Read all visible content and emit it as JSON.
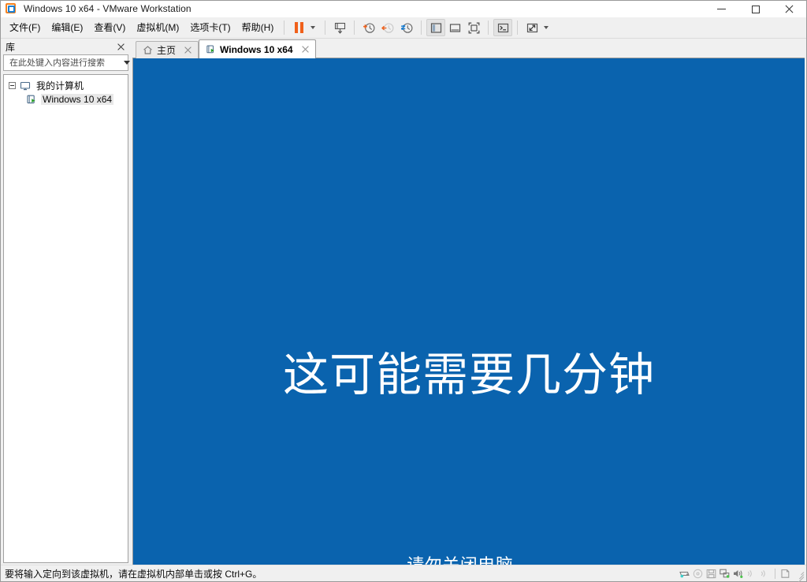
{
  "window": {
    "title": "Windows 10 x64 - VMware Workstation",
    "app_icon": "vmware-logo-icon",
    "controls": {
      "minimize": "minimize-icon",
      "maximize": "maximize-icon",
      "close": "close-icon"
    }
  },
  "menu": {
    "items": [
      {
        "label": "文件(F)",
        "mnemonic": "F"
      },
      {
        "label": "编辑(E)",
        "mnemonic": "E"
      },
      {
        "label": "查看(V)",
        "mnemonic": "V"
      },
      {
        "label": "虚拟机(M)",
        "mnemonic": "M"
      },
      {
        "label": "选项卡(T)",
        "mnemonic": "T"
      },
      {
        "label": "帮助(H)",
        "mnemonic": "H"
      }
    ]
  },
  "toolbar": {
    "groups": [
      {
        "buttons": [
          {
            "name": "suspend-button",
            "icon": "pause-icon",
            "active": false
          },
          {
            "name": "power-dropdown",
            "icon": "chevron-down-icon",
            "active": false
          }
        ]
      },
      {
        "buttons": [
          {
            "name": "manage-vm-button",
            "icon": "vm-settings-icon",
            "active": false
          }
        ]
      },
      {
        "buttons": [
          {
            "name": "take-snapshot-button",
            "icon": "snapshot-add-icon",
            "active": false
          },
          {
            "name": "revert-snapshot-button",
            "icon": "snapshot-revert-icon",
            "active": false
          },
          {
            "name": "snapshot-manager-button",
            "icon": "snapshot-manager-icon",
            "active": false
          }
        ]
      },
      {
        "buttons": [
          {
            "name": "show-library-button",
            "icon": "library-panel-icon",
            "active": true
          },
          {
            "name": "show-thumbnail-bar-button",
            "icon": "thumbnail-bar-icon",
            "active": false
          },
          {
            "name": "full-screen-button",
            "icon": "fullscreen-icon",
            "active": false
          }
        ]
      },
      {
        "buttons": [
          {
            "name": "console-view-button",
            "icon": "console-icon",
            "active": true
          }
        ]
      },
      {
        "buttons": [
          {
            "name": "stretch-view-button",
            "icon": "stretch-icon",
            "active": false
          },
          {
            "name": "stretch-dropdown",
            "icon": "chevron-down-icon",
            "active": false
          }
        ]
      }
    ]
  },
  "library": {
    "title": "库",
    "close_label": "close-icon",
    "search": {
      "placeholder": "在此处键入内容进行搜索",
      "value": "",
      "icon": "search-icon",
      "dropdown_icon": "chevron-down-icon"
    },
    "tree": [
      {
        "label": "我的计算机",
        "icon": "monitor-icon",
        "expanded": true,
        "selected": false,
        "children": [
          {
            "label": "Windows 10 x64",
            "icon": "vm-running-icon",
            "selected": true
          }
        ]
      }
    ]
  },
  "tabs": [
    {
      "label": "主页",
      "icon": "home-icon",
      "active": false,
      "closable": true
    },
    {
      "label": "Windows 10 x64",
      "icon": "vm-running-icon",
      "active": true,
      "closable": true
    }
  ],
  "vm_screen": {
    "background_color": "#0A63AE",
    "headline": "这可能需要几分钟",
    "subtext": "请勿关闭电脑。"
  },
  "status_bar": {
    "message": "要将输入定向到该虚拟机，请在虚拟机内部单击或按 Ctrl+G。",
    "devices": [
      {
        "name": "hard-disk-icon",
        "label": "硬盘",
        "connected": true
      },
      {
        "name": "cd-dvd-icon",
        "label": "CD/DVD",
        "connected": false
      },
      {
        "name": "floppy-icon",
        "label": "软盘",
        "connected": false
      },
      {
        "name": "network-adapter-icon",
        "label": "网络适配器",
        "connected": true
      },
      {
        "name": "sound-card-icon",
        "label": "声卡",
        "connected": true
      },
      {
        "name": "usb-device-1-icon",
        "label": "USB 设备",
        "connected": false
      },
      {
        "name": "usb-device-2-icon",
        "label": "USB 设备",
        "connected": false
      },
      {
        "name": "printer-icon",
        "label": "打印机",
        "connected": false
      }
    ],
    "resize_grip": "resize-grip-icon"
  },
  "colors": {
    "windows_setup_blue": "#0A63AE",
    "vmware_orange": "#F58220",
    "vmware_blue": "#1A7FD4",
    "chrome_gray": "#F0F0F0"
  }
}
